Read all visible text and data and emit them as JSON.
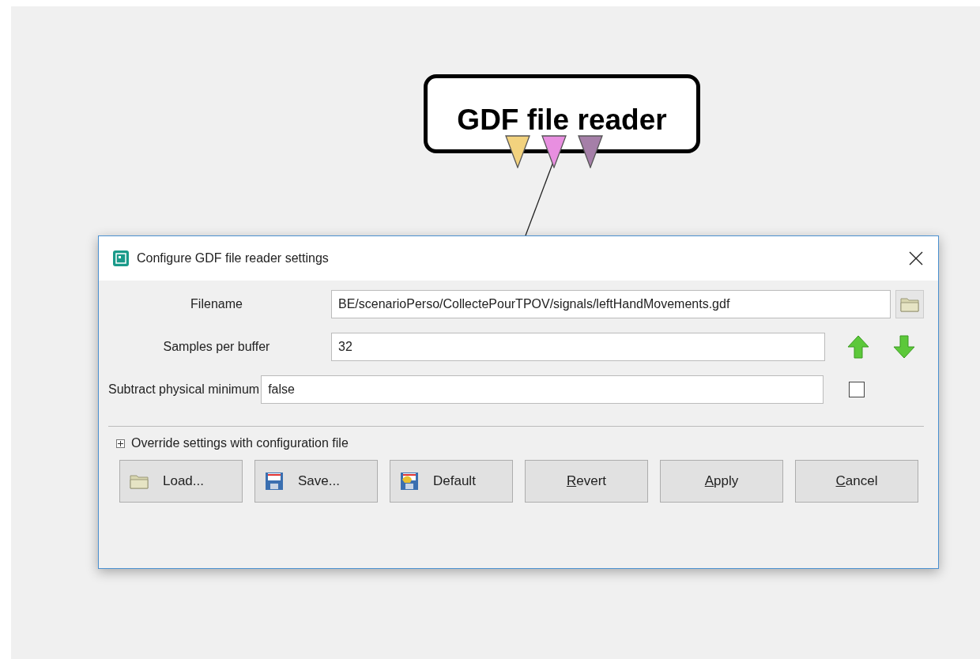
{
  "node": {
    "title": "GDF file reader",
    "outputs": [
      {
        "color": "#f2d27e"
      },
      {
        "color": "#e88fe0"
      },
      {
        "color": "#a57fa8"
      }
    ]
  },
  "dialog": {
    "title": "Configure GDF file reader settings",
    "settings": [
      {
        "kind": "file",
        "label": "Filename",
        "value": "BE/scenarioPerso/CollectePourTPOV/signals/leftHandMovements.gdf"
      },
      {
        "kind": "integer",
        "label": "Samples per buffer",
        "value": "32"
      },
      {
        "kind": "boolean",
        "label": "Subtract physical minimum",
        "value": "false",
        "checked": false
      }
    ],
    "override": {
      "label": "Override settings with configuration file",
      "expanded": false
    },
    "buttons": [
      {
        "kind": "load",
        "label": "Load...",
        "mnemonic": false
      },
      {
        "kind": "save",
        "label": "Save...",
        "mnemonic": false
      },
      {
        "kind": "default",
        "label": "Default",
        "mnemonic": false
      },
      {
        "kind": "plain",
        "label": "Revert",
        "mnemonic": true
      },
      {
        "kind": "plain",
        "label": "Apply",
        "mnemonic": true
      },
      {
        "kind": "plain",
        "label": "Cancel",
        "mnemonic": true
      }
    ]
  }
}
